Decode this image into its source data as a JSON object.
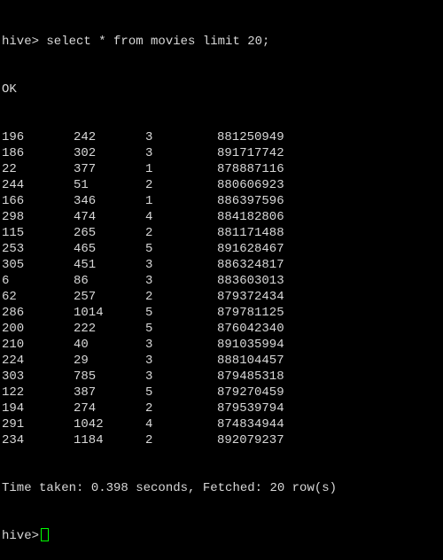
{
  "terminal": {
    "command_line": "hive> select * from movies limit 20;",
    "status": "OK",
    "rows": [
      [
        "196",
        "242",
        "3",
        "881250949"
      ],
      [
        "186",
        "302",
        "3",
        "891717742"
      ],
      [
        "22",
        "377",
        "1",
        "878887116"
      ],
      [
        "244",
        "51",
        "2",
        "880606923"
      ],
      [
        "166",
        "346",
        "1",
        "886397596"
      ],
      [
        "298",
        "474",
        "4",
        "884182806"
      ],
      [
        "115",
        "265",
        "2",
        "881171488"
      ],
      [
        "253",
        "465",
        "5",
        "891628467"
      ],
      [
        "305",
        "451",
        "3",
        "886324817"
      ],
      [
        "6",
        "86",
        "3",
        "883603013"
      ],
      [
        "62",
        "257",
        "2",
        "879372434"
      ],
      [
        "286",
        "1014",
        "5",
        "879781125"
      ],
      [
        "200",
        "222",
        "5",
        "876042340"
      ],
      [
        "210",
        "40",
        "3",
        "891035994"
      ],
      [
        "224",
        "29",
        "3",
        "888104457"
      ],
      [
        "303",
        "785",
        "3",
        "879485318"
      ],
      [
        "122",
        "387",
        "5",
        "879270459"
      ],
      [
        "194",
        "274",
        "2",
        "879539794"
      ],
      [
        "291",
        "1042",
        "4",
        "874834944"
      ],
      [
        "234",
        "1184",
        "2",
        "892079237"
      ]
    ],
    "summary": "Time taken: 0.398 seconds, Fetched: 20 row(s)",
    "prompt": "hive>",
    "colors": {
      "background": "#000000",
      "text": "#d8d8d8",
      "cursor": "#00ff00"
    }
  }
}
